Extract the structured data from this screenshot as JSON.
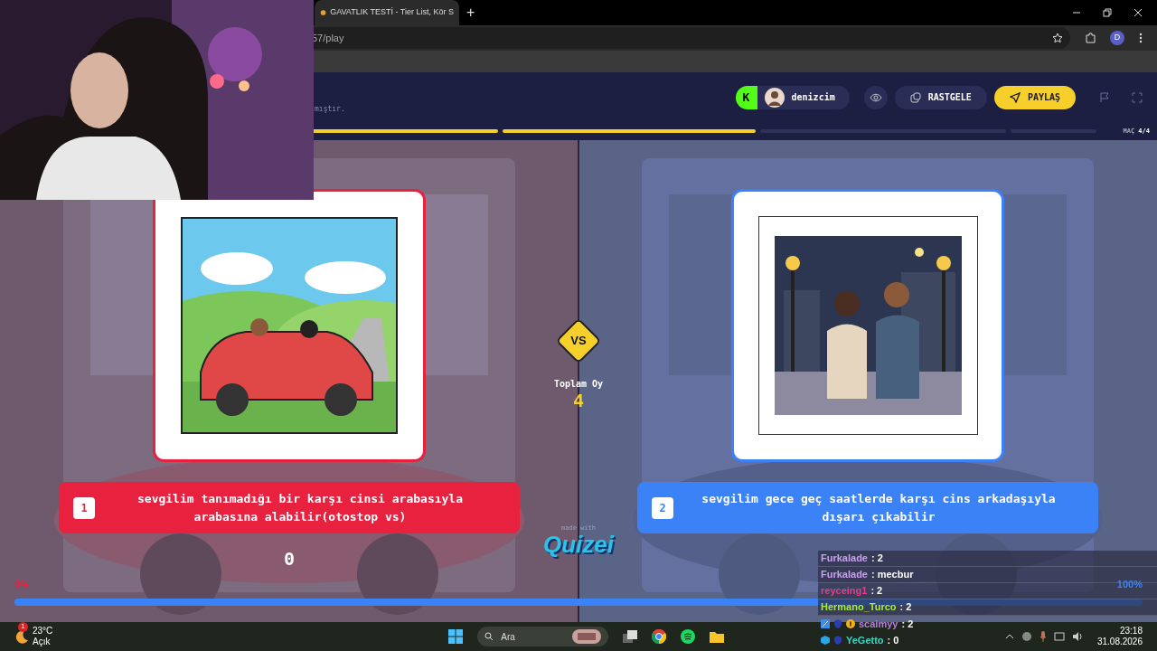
{
  "browser": {
    "tab_title": "GAVATLIK TESTİ - Tier List, Kör S",
    "new_tab": "+",
    "url": "57/play",
    "profile": "D"
  },
  "header": {
    "subtitle": "mıştır.",
    "creator": {
      "platform": "K",
      "name": "denizcim"
    },
    "buttons": [
      {
        "kind": "eye"
      },
      {
        "kind": "random",
        "label": "RASTGELE"
      },
      {
        "kind": "share",
        "label": "PAYLAŞ"
      },
      {
        "kind": "flag"
      },
      {
        "kind": "fullscreen"
      }
    ]
  },
  "progress": {
    "segments": [
      {
        "level": 1
      },
      {
        "level": 1
      },
      {
        "level": 0
      },
      {
        "level": 0
      }
    ],
    "label": "MAÇ",
    "count": "4/4"
  },
  "options": [
    {
      "number": "1",
      "text": "sevgilim tanımadığı bir karşı cinsi arabasıyla arabasına alabilir(otostop vs)",
      "color": "#e8213f",
      "votes": "0",
      "percent": "0%"
    },
    {
      "number": "2",
      "text": "sevgilim gece geç saatlerde karşı cins arkadaşıyla dışarı çıkabilir",
      "color": "#3b82f6",
      "percent": "100%"
    }
  ],
  "vs": "VS",
  "total_label": "Toplam Oy",
  "total": "4",
  "made_with": "made with",
  "logo": "Quizei",
  "vote_bar": {
    "level": 1
  },
  "chat": [
    {
      "user": "Furkalade",
      "message": ": 2",
      "color": "#c9a0f0",
      "kind": "band"
    },
    {
      "user": "Furkalade",
      "message": ": mecbur",
      "color": "#c9a0f0",
      "kind": "band"
    },
    {
      "user": "reyceing1",
      "message": ": 2",
      "color": "#e0408a",
      "kind": "band"
    },
    {
      "user": "Hermano_Turco",
      "message": ": 2",
      "color": "#a3f03c",
      "kind": "band"
    },
    {
      "user": "scaimyy",
      "message": ": 2",
      "color": "#b77ee0",
      "kind": "subscriber"
    },
    {
      "user": "YeGetto",
      "message": ": 0",
      "color": "#3fd6c0",
      "kind": "member"
    }
  ],
  "taskbar": {
    "weather": {
      "temp": "23°C",
      "condition": "Açık",
      "notification": "1"
    },
    "search_placeholder": "Ara",
    "time": "23:18",
    "date": "31.08.2026"
  }
}
